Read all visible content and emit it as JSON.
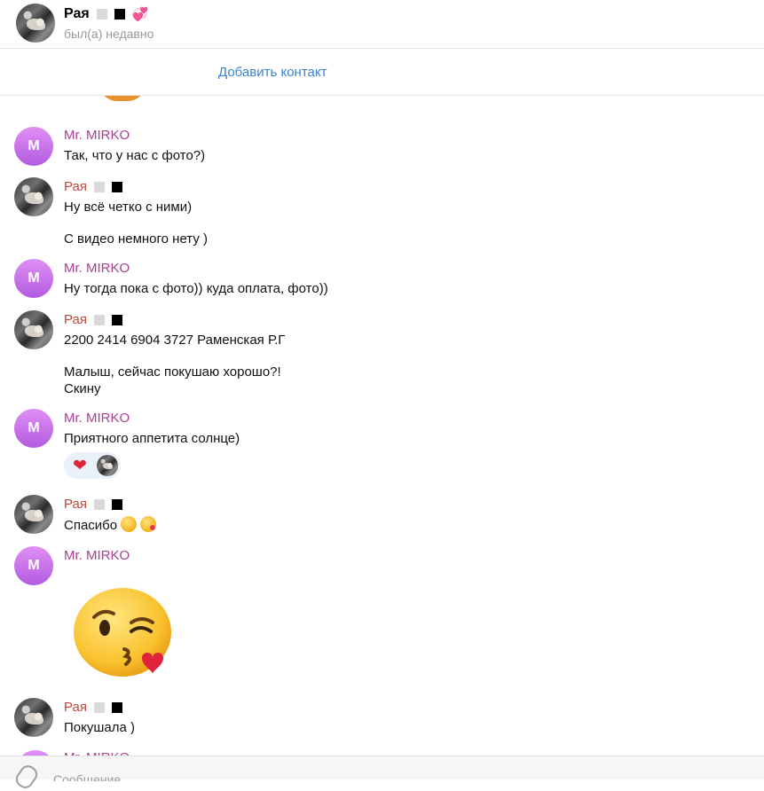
{
  "header": {
    "name": "Рая",
    "status": "был(а) недавно"
  },
  "addbar": {
    "label": "Добавить контакт"
  },
  "messages": [
    {
      "sender": "Mr. MIRKO",
      "initial": "M",
      "text": "Так, что у нас с фото?)"
    },
    {
      "sender": "Рая",
      "text": "Ну всё четко с ними)"
    },
    {
      "text": "С видео немного нету )"
    },
    {
      "sender": "Mr. MIRKO",
      "initial": "M",
      "text": "Ну тогда пока с фото)) куда оплата, фото))"
    },
    {
      "sender": "Рая",
      "text": "2200 2414 6904 3727 Раменская Р.Г"
    },
    {
      "text": "Малыш, сейчас покушаю хорошо?!\nСкину"
    },
    {
      "sender": "Mr. MIRKO",
      "initial": "M",
      "text": "Приятного аппетита солнце)"
    },
    {
      "sender": "Рая",
      "text": "Спасибо"
    },
    {
      "sender": "Mr. MIRKO",
      "initial": "M"
    },
    {
      "sender": "Рая",
      "text": "Покушала )"
    },
    {
      "sender": "Mr. MIRKO",
      "initial": "M"
    }
  ],
  "reaction": {
    "emoji": "heart"
  },
  "composer": {
    "placeholder": "Сообщение"
  },
  "colors": {
    "accent_link": "#3a84c9",
    "mirko_name": "#a7418f",
    "raya_name": "#c2473c",
    "avatar_m": "#c070ea"
  }
}
